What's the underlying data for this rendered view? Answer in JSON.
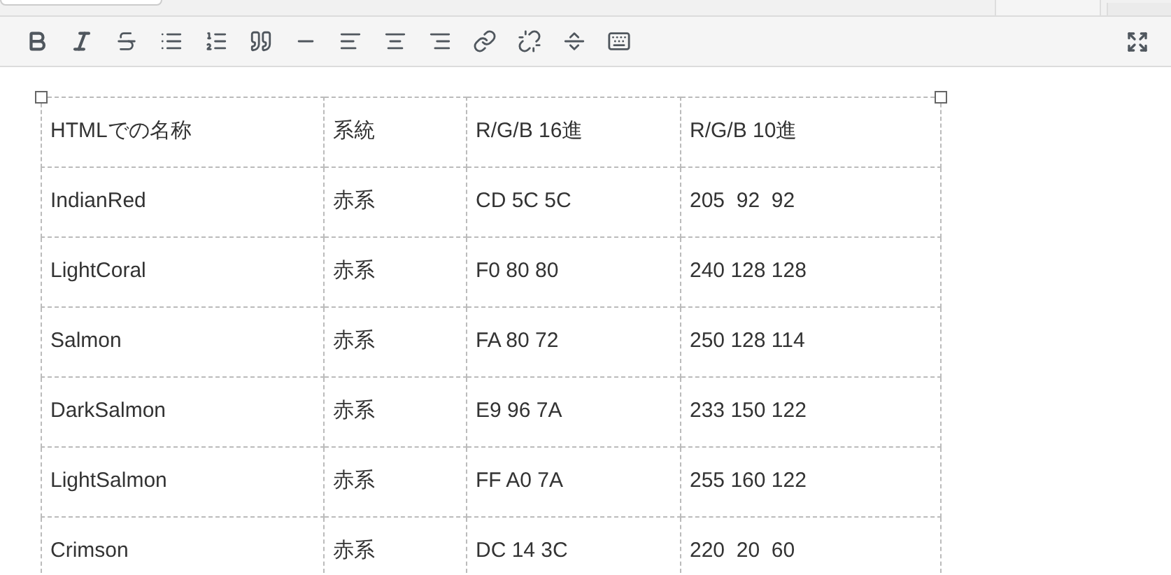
{
  "editor_tabs": [
    {
      "selected": true
    },
    {
      "selected": false
    }
  ],
  "table": {
    "columns": [
      "HTMLでの名称",
      "系統",
      "R/G/B 16進",
      "R/G/B 10進"
    ],
    "rows": [
      [
        "IndianRed",
        "赤系",
        "CD 5C 5C",
        "205  92  92"
      ],
      [
        "LightCoral",
        "赤系",
        "F0 80 80",
        "240 128 128"
      ],
      [
        "Salmon",
        "赤系",
        "FA 80 72",
        "250 128 114"
      ],
      [
        "DarkSalmon",
        "赤系",
        "E9 96 7A",
        "233 150 122"
      ],
      [
        "LightSalmon",
        "赤系",
        "FF A0 7A",
        "255 160 122"
      ],
      [
        "Crimson",
        "赤系",
        "DC 14 3C",
        "220  20  60"
      ]
    ]
  }
}
